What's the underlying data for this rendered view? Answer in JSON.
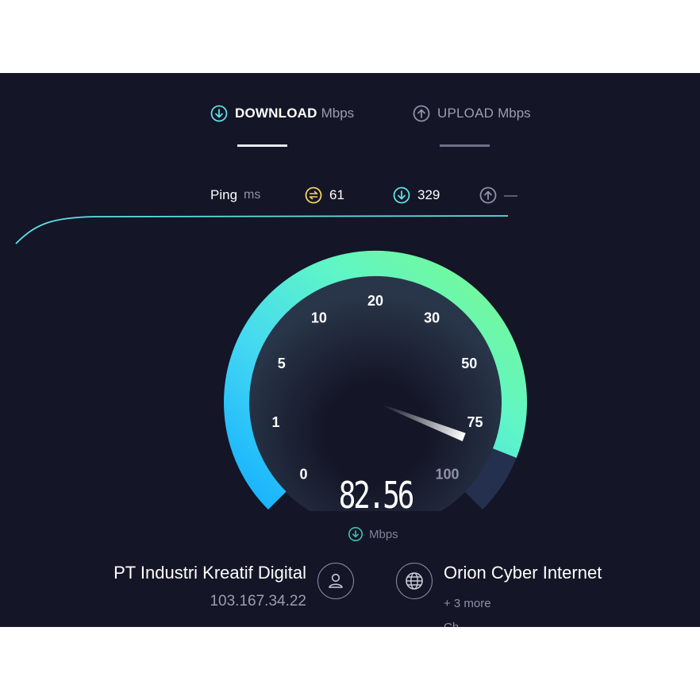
{
  "tabs": {
    "download": {
      "label": "DOWNLOAD",
      "unit": "Mbps",
      "active": true
    },
    "upload": {
      "label": "UPLOAD",
      "unit": "Mbps",
      "active": false
    }
  },
  "ping": {
    "label": "Ping",
    "unit": "ms",
    "idle": "61",
    "download": "329",
    "upload": "—"
  },
  "gauge": {
    "ticks": [
      "0",
      "1",
      "5",
      "10",
      "20",
      "30",
      "50",
      "75",
      "100"
    ],
    "value": 82.56,
    "value_display": "82.56",
    "unit": "Mbps"
  },
  "colors": {
    "background": "#141526",
    "gauge_start": "#1fb6ff",
    "gauge_end": "#7cf98a",
    "ping_idle": "#f4d35e",
    "accent": "#5ce1e6"
  },
  "client": {
    "isp": "PT Industri Kreatif Digital",
    "ip": "103.167.34.22",
    "icon": "user-icon"
  },
  "server": {
    "name": "Orion Cyber Internet",
    "more": "+ 3 more",
    "cut": "Ch",
    "icon": "globe-icon"
  }
}
